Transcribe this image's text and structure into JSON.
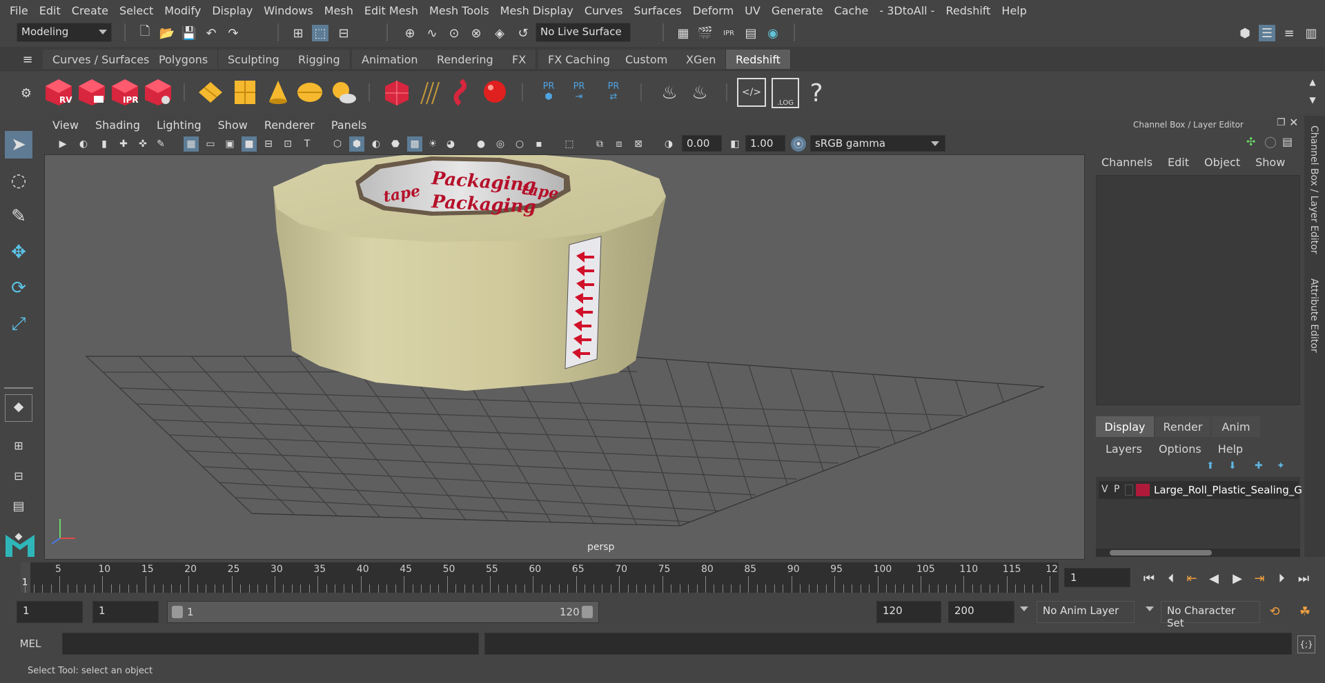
{
  "menubar": {
    "items": [
      "File",
      "Edit",
      "Create",
      "Select",
      "Modify",
      "Display",
      "Windows",
      "Mesh",
      "Edit Mesh",
      "Mesh Tools",
      "Mesh Display",
      "Curves",
      "Surfaces",
      "Deform",
      "UV",
      "Generate",
      "Cache",
      "- 3DtoAll -",
      "Redshift",
      "Help"
    ]
  },
  "statusline": {
    "menuset": "Modeling",
    "live_surface": "No Live Surface"
  },
  "shelf": {
    "tabs": [
      "Curves / Surfaces",
      "Polygons",
      "Sculpting",
      "Rigging",
      "Animation",
      "Rendering",
      "FX",
      "FX Caching",
      "Custom",
      "XGen",
      "Redshift"
    ],
    "active_tab": "Redshift",
    "cube_labels": [
      "RV",
      "",
      "IPR",
      ""
    ],
    "pr_labels": [
      "PR",
      "PR",
      "PR"
    ],
    "log_label": ".LOG",
    "help_glyph": "?"
  },
  "viewport": {
    "menu": [
      "View",
      "Shading",
      "Lighting",
      "Show",
      "Renderer",
      "Panels"
    ],
    "exposure": "0.00",
    "gamma": "1.00",
    "colorspace": "sRGB gamma",
    "camera": "persp",
    "tape_text_1": "Packaging",
    "tape_text_2": "tape"
  },
  "channelbox": {
    "title": "Channel Box / Layer Editor",
    "menu": [
      "Channels",
      "Edit",
      "Object",
      "Show"
    ],
    "tabs": [
      "Display",
      "Render",
      "Anim"
    ],
    "active_tab": "Display",
    "layer_menu": [
      "Layers",
      "Options",
      "Help"
    ],
    "layer": {
      "v": "V",
      "p": "P",
      "name": "Large_Roll_Plastic_Sealing_G",
      "color": "#b01a3a"
    },
    "side_tabs": [
      "Channel Box / Layer Editor",
      "Attribute Editor"
    ]
  },
  "timeline": {
    "ticks": [
      "5",
      "10",
      "15",
      "20",
      "25",
      "30",
      "35",
      "40",
      "45",
      "50",
      "55",
      "60",
      "65",
      "70",
      "75",
      "80",
      "85",
      "90",
      "95",
      "100",
      "105",
      "110",
      "115",
      "12"
    ],
    "current_marker": "1",
    "current_frame": "1"
  },
  "range": {
    "start": "1",
    "playback_start": "1",
    "slider_start": "1",
    "slider_end": "120",
    "playback_end": "120",
    "end": "200",
    "anim_layer": "No Anim Layer",
    "char_set": "No Character Set"
  },
  "command": {
    "mel_label": "MEL",
    "status": "Select Tool: select an object"
  },
  "colors": {
    "accent": "#5f7a93",
    "tape": "#d8d1a6",
    "layer_swatch": "#b01a3a"
  }
}
